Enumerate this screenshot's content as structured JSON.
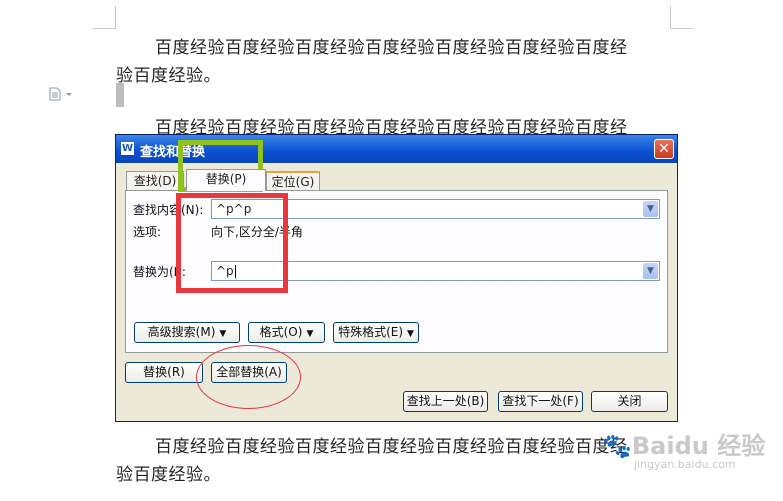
{
  "document": {
    "para1_line1": "百度经验百度经验百度经验百度经验百度经验百度经验百度经",
    "para1_line2": "验百度经验。",
    "para2_line1": "百度经验百度经验百度经验百度经验百度经验百度经验百度经",
    "para3_line1": "百度经验百度经验百度经验百度经验百度经验百度经验百度经",
    "para3_line2": "验百度经验。"
  },
  "dialog": {
    "title": "查找和替换",
    "app_icon_text": "W",
    "close_glyph": "✕",
    "tabs": [
      {
        "label": "查找(D)"
      },
      {
        "label": "替换(P)"
      },
      {
        "label": "定位(G)"
      }
    ],
    "find": {
      "label": "查找内容(N):",
      "value": "^p^p"
    },
    "options": {
      "label": "选项:",
      "value": "向下,区分全/半角"
    },
    "replace": {
      "label": "替换为(I):",
      "value": "^p"
    },
    "buttons": {
      "advanced": "高级搜索(M)",
      "format": "格式(O)",
      "special": "特殊格式(E)",
      "replace_one": "替换(R)",
      "replace_all": "全部替换(A)",
      "find_prev": "查找上一处(B)",
      "find_next": "查找下一处(F)",
      "close": "关闭"
    }
  },
  "watermark": {
    "brand": "Baidu 经验",
    "url": "jingyan.baidu.com"
  }
}
